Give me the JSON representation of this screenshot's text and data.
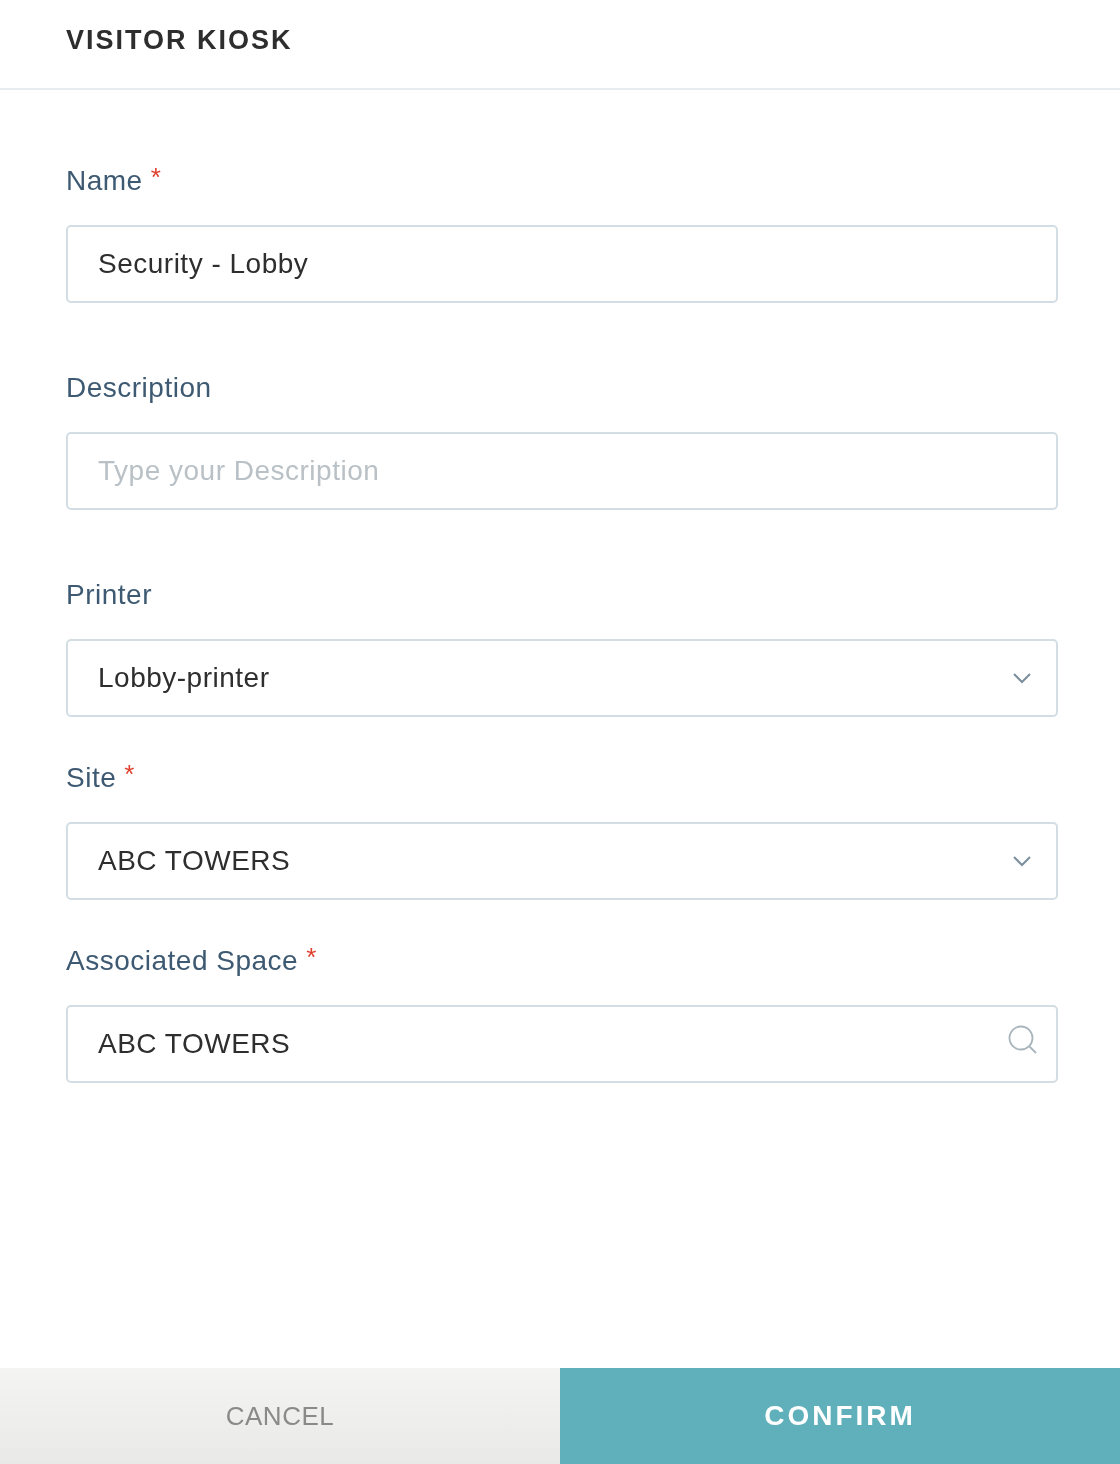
{
  "header": {
    "title": "VISITOR KIOSK"
  },
  "fields": [
    {
      "label": "Name",
      "required": true,
      "kind": "text",
      "value": "Security - Lobby"
    },
    {
      "label": "Description",
      "required": false,
      "kind": "text",
      "placeholder": "Type your Description"
    },
    {
      "label": "Printer",
      "required": false,
      "kind": "select",
      "value": "Lobby-printer"
    },
    {
      "label": "Site",
      "required": true,
      "kind": "select",
      "value": "ABC TOWERS"
    },
    {
      "label": "Associated Space",
      "required": true,
      "kind": "search",
      "value": "ABC TOWERS"
    }
  ],
  "required_mark": "*",
  "buttons": [
    {
      "label": "CANCEL",
      "kind": "secondary"
    },
    {
      "label": "CONFIRM",
      "kind": "primary"
    }
  ]
}
